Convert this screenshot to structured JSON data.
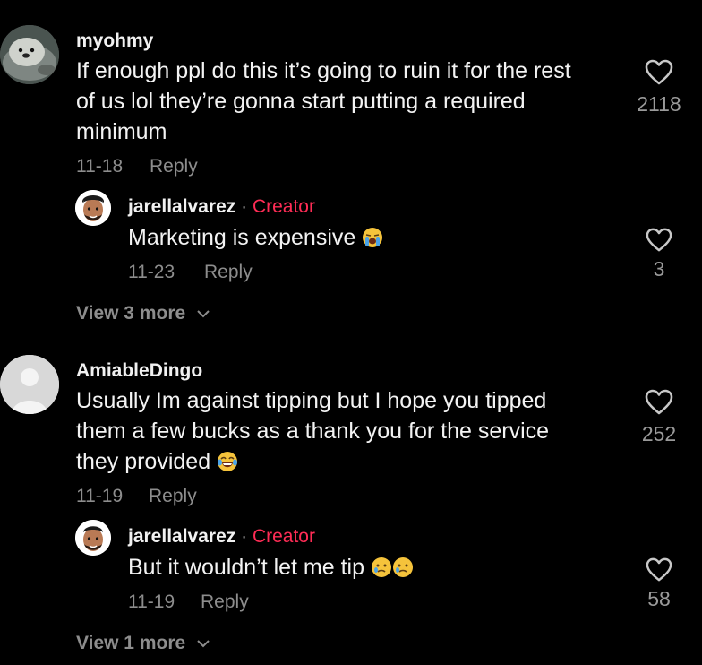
{
  "comments": [
    {
      "username": "myohmy",
      "text_lines": [
        "If enough ppl do this it’s going to ruin it for the rest",
        "of us lol they’re gonna start putting a required",
        "minimum"
      ],
      "date": "11-18",
      "reply_label": "Reply",
      "likes": "2118",
      "avatar": "otter-avatar",
      "reply": {
        "username": "jarellalvarez",
        "separator": "·",
        "badge": "Creator",
        "text": "Marketing is expensive",
        "emoji": "loudly-crying-face-emoji",
        "date": "11-23",
        "reply_label": "Reply",
        "likes": "3"
      },
      "view_more": "View 3 more"
    },
    {
      "username": "AmiableDingo",
      "text_lines": [
        "Usually Im against tipping but I hope you tipped",
        "them a few bucks as a thank you for the service",
        "they provided"
      ],
      "emoji": "tears-of-joy-emoji",
      "date": "11-19",
      "reply_label": "Reply",
      "likes": "252",
      "avatar": "default-avatar",
      "reply": {
        "username": "jarellalvarez",
        "separator": "·",
        "badge": "Creator",
        "text": "But it wouldn’t let me tip",
        "emoji": "crying-face-emoji",
        "date": "11-19",
        "reply_label": "Reply",
        "likes": "58"
      },
      "view_more": "View 1 more"
    }
  ],
  "colors": {
    "background": "#000000",
    "creator_badge": "#fe2c55",
    "muted_text": "#8d8d8d"
  }
}
